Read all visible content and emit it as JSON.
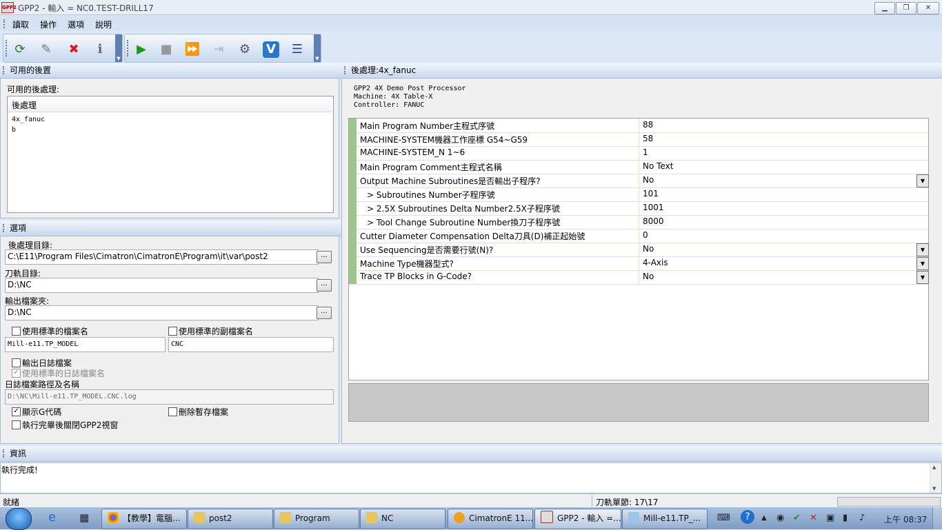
{
  "window": {
    "title": "GPP2 - 輸入 = NC0.TEST-DRILL17",
    "app_icon": "GPP2",
    "min": "▁",
    "restore": "❐",
    "close": "✕"
  },
  "menu": [
    "讀取",
    "操作",
    "選項",
    "說明"
  ],
  "left_panel": {
    "title": "可用的後置",
    "list_caption": "可用的後處理:",
    "list_header": "後處理",
    "items": [
      "4x_fanuc",
      "b"
    ]
  },
  "options": {
    "title": "選項",
    "post_dir_label": "後處理目錄:",
    "post_dir": "C:\\E11\\Program Files\\Cimatron\\CimatronE\\Program\\it\\var\\post2",
    "toolpath_dir_label": "刀軌目錄:",
    "toolpath_dir": "D:\\NC",
    "output_dir_label": "輸出檔案夾:",
    "output_dir": "D:\\NC",
    "browse": "...",
    "use_std_name": "使用標準的檔案名",
    "use_std_ext": "使用標準的副檔案名",
    "file_name": "Mill-e11.TP_MODEL",
    "file_ext": "CNC",
    "output_log": "輸出日誌檔案",
    "use_std_log": "使用標準的日誌檔案名",
    "log_path_label": "日誌檔案路徑及名稱",
    "log_path": "D:\\NC\\Mill-e11.TP_MODEL.CNC.log",
    "show_gcode": "顯示G代碼",
    "show_gcode_checked": "✓",
    "use_std_log_checked": "✓",
    "delete_temp": "刪除暫存檔案",
    "close_after": "執行完畢後關閉GPP2視窗"
  },
  "right_panel": {
    "title": "後處理:4x_fanuc",
    "description": [
      "GPP2 4X Demo Post Processor",
      "Machine: 4X Table-X",
      "Controller: FANUC"
    ],
    "dropdown_glyph": "▼",
    "rows": [
      {
        "key": "Main Program Number主程式序號",
        "value": "88"
      },
      {
        "key": "MACHINE-SYSTEM機器工作座標 G54~G59",
        "value": "58"
      },
      {
        "key": "MACHINE-SYSTEM_N 1~6",
        "value": "1"
      },
      {
        "key": "Main Program Comment主程式名稱",
        "value": "No Text"
      },
      {
        "key": "Output Machine Subroutines是否輸出子程序?",
        "value": "No"
      },
      {
        "key": "> Subroutines Number子程序號",
        "value": "101"
      },
      {
        "key": "> 2.5X Subroutines Delta Number2.5X子程序號",
        "value": "1001"
      },
      {
        "key": "> Tool Change Subroutine Number換刀子程序號",
        "value": "8000"
      },
      {
        "key": "Cutter Diameter Compensation Delta刀具(D)補正起始號",
        "value": "0"
      },
      {
        "key": "Use Sequencing是否需要行號(N)?",
        "value": "No"
      },
      {
        "key": "Machine Type機器型式?",
        "value": "4-Axis"
      },
      {
        "key": "Trace TP Blocks in G-Code?",
        "value": "No"
      }
    ]
  },
  "info": {
    "title": "資訊",
    "message": "執行完成!"
  },
  "status": {
    "left": "就緒",
    "middle": "刀軌單節: 17\\17"
  },
  "taskbar": {
    "items": [
      "【教學】電腦...",
      "post2",
      "Program",
      "NC",
      "CimatronE 11...",
      "GPP2 - 輸入 =...",
      "Mill-e11.TP_..."
    ],
    "clock": "上午 08:37"
  },
  "colors": {
    "accent_green": "#9fc58c",
    "panel_header": "#c9d8ee",
    "taskbar": "#7e9cc5"
  }
}
